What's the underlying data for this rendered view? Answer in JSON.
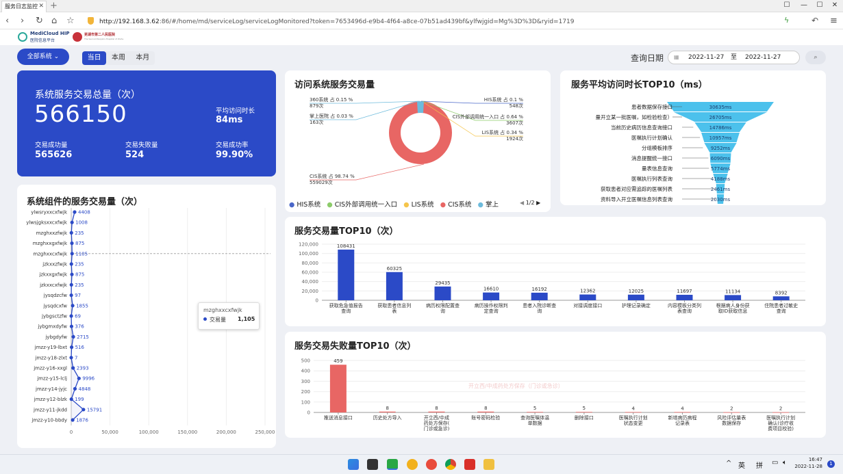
{
  "browser": {
    "tab_title": "服务日志监控",
    "new_tab": "+",
    "url_host": "http://192.168.3.62",
    "url_rest": ":86/#/home/md/serviceLog/serviceLogMonitored?token=7653496d-e9b4-4f64-a8ce-07b51ad439bf&ylfwjgid=Mg%3D%3D&ryid=1719",
    "controls": [
      "☐",
      "—",
      "☐",
      "✕"
    ]
  },
  "header": {
    "logo_main": "MediCloud HIP",
    "logo_sub": "医院信息平台",
    "hospital_name": "芜湖市第二人民医院",
    "hospital_sub": "The Second People's Hospital of Wuhu",
    "system_select": "全部系统",
    "periods": [
      "当日",
      "本周",
      "本月"
    ],
    "active_period": "当日",
    "query_label": "查询日期",
    "date_from": "2022-11-27",
    "date_sep": "至",
    "date_to": "2022-11-27"
  },
  "summary": {
    "title": "系统服务交易总量（次）",
    "total": "566150",
    "avg_label": "平均访问时长",
    "avg_value": "84ms",
    "success_label": "交易成功量",
    "success_value": "565626",
    "fail_label": "交易失败量",
    "fail_value": "524",
    "rate_label": "交易成功率",
    "rate_value": "99.90%"
  },
  "components": {
    "title": "系统组件的服务交易量（次）",
    "names": [
      "ylwsryxxcxfwjk",
      "ylwsjgksxxcxfwjk",
      "mzghxxzfwjk",
      "mzghxxgxfwjk",
      "mzghxxcxfwjk",
      "jzkxxzfwjk",
      "jzkxxgxfwjk",
      "jzkxxcxfwjk",
      "jysqdzcfw",
      "jysqdcxfw",
      "jybgsctzfw",
      "jybgmxdyfw",
      "jybgdyfw",
      "jmzz-y19-lbxt",
      "jmzz-y18-zlxt",
      "jmzz-y16-xxgl",
      "jmzz-y15-lclj",
      "jmzz-y14-jyjc",
      "jmzz-y12-blzk",
      "jmzz-y11-jkdd",
      "jmzz-y10-bbdy"
    ],
    "values": [
      4408,
      1008,
      235,
      875,
      1105,
      235,
      875,
      235,
      97,
      1855,
      69,
      376,
      2715,
      516,
      7,
      2393,
      9996,
      4848,
      199,
      15791,
      1876
    ],
    "ticks": [
      "0",
      "50,000",
      "100,000",
      "150,000",
      "200,000",
      "250,000"
    ],
    "tooltip_title": "mzghxxcxfwjk",
    "tooltip_series": "交易量",
    "tooltip_value": "1,105"
  },
  "pie": {
    "title": "访问系统服务交易量",
    "labels": [
      {
        "t1": "360系统 占 0.15 %",
        "t2": "879次"
      },
      {
        "t1": "掌上医院 占 0.03 %",
        "t2": "163次"
      },
      {
        "t1": "CIS系统 占 98.74 %",
        "t2": "559029次"
      },
      {
        "t1": "HIS系统 占 0.1 %",
        "t2": "548次"
      },
      {
        "t1": "CIS外部调用统一入口 占 0.64 %",
        "t2": "3607次"
      },
      {
        "t1": "LIS系统 占 0.34 %",
        "t2": "1924次"
      }
    ],
    "legend": [
      "HIS系统",
      "CIS外部调用统一入口",
      "LIS系统",
      "CIS系统",
      "掌上"
    ],
    "legend_page": "1/2"
  },
  "chart_data": [
    {
      "type": "bar",
      "title": "服务平均访问时长TOP10（ms）",
      "categories": [
        "患者数据保存接口",
        "量开立某一批医嘱，如检验检查）",
        "当前历史病历信息查询接口",
        "医嘱执行计划确认",
        "分组模板排序",
        "消息提醒统一接口",
        "量表信息查询",
        "医嘱执行列表查询",
        "获取患者对应需追踪的医嘱列表",
        "资料导入开立医嘱信息列表查询"
      ],
      "values": [
        30635,
        26705,
        14786,
        10957,
        9252,
        6090,
        5774,
        4188,
        2461,
        2030
      ],
      "value_labels": [
        "30635ms",
        "26705ms",
        "14786ms",
        "10957ms",
        "9252ms",
        "6090ms",
        "5774ms",
        "4188ms",
        "2461ms",
        "2030ms"
      ]
    },
    {
      "type": "bar",
      "title": "服务交易量TOP10（次）",
      "categories": [
        "获取危急值报告查询",
        "获取患者信息列表",
        "病历权限配置查询",
        "病历操作权限判定查询",
        "患者入院诊断查询",
        "对接调度接口",
        "护理记录确定",
        "内容模板分类列表查询",
        "根据病人身份获取ID获取信息",
        "住院患者过敏史查询"
      ],
      "values": [
        108431,
        60325,
        29435,
        16610,
        16192,
        12362,
        12025,
        11697,
        11134,
        8392
      ],
      "yticks": [
        "0",
        "20,000",
        "40,000",
        "60,000",
        "80,000",
        "100,000",
        "120,000"
      ]
    },
    {
      "type": "bar",
      "title": "服务交易失败量TOP10（次）",
      "categories": [
        "推送消息接口",
        "历史处方导入",
        "开立西/中成药处方保存(门诊或急诊)",
        "账号密码检验",
        "查询医嘱体温单数据",
        "删除接口",
        "医嘱执行计划状态变更",
        "新增病历病程记录表",
        "风险评估量表数据保存",
        "医嘱执行计划确认(诊疗收费项目校验)"
      ],
      "values": [
        459,
        8,
        8,
        8,
        5,
        5,
        4,
        4,
        2,
        2
      ],
      "yticks": [
        "0",
        "100",
        "200",
        "300",
        "400",
        "500"
      ],
      "ghost_tooltip": "开立西/中成药处方保存（门诊或急诊）"
    }
  ],
  "taskbar": {
    "time": "16:47",
    "date": "2022-11-28",
    "lang": "英",
    "ime": "拼",
    "badge": "1"
  },
  "colors": {
    "primary": "#2b4ac7",
    "pie_red": "#e86664",
    "funnel": "#4cc1ec",
    "fail_red": "#e86664"
  }
}
